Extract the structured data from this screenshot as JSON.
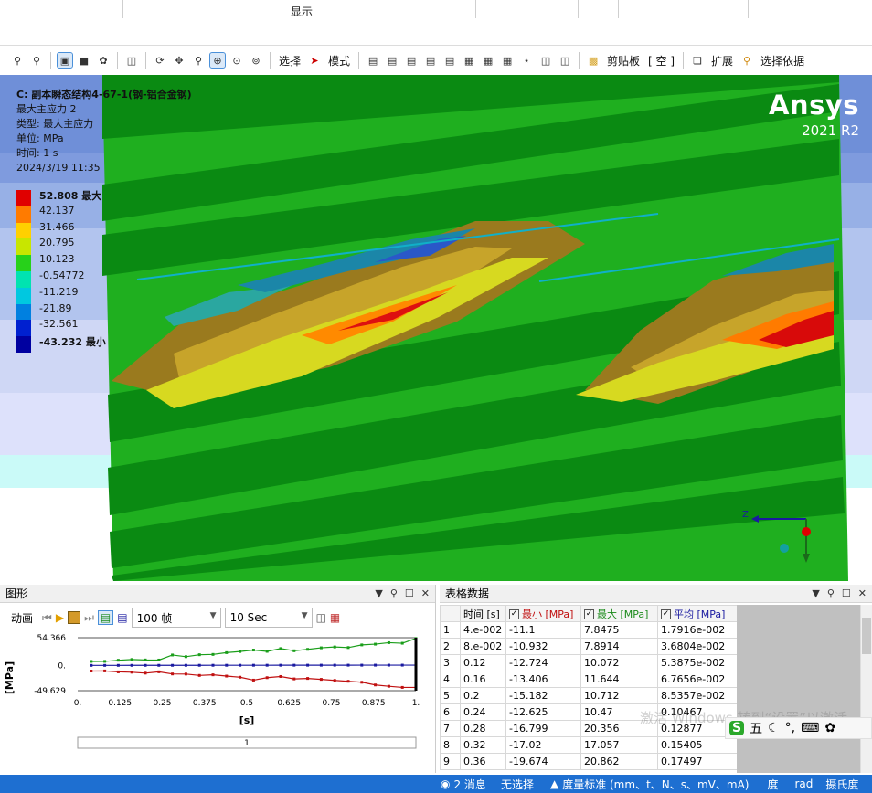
{
  "ribbon": {
    "group_label": "显示"
  },
  "toolbar": {
    "select_label": "选择",
    "mode_label": "模式",
    "clipboard_label": "剪贴板",
    "empty_label": "[ 空 ]",
    "extend_label": "扩展",
    "select_by_label": "选择依据"
  },
  "result_info": {
    "title": "C: 副本瞬态结构4-67-1(钢-铝合金钢)",
    "result_name": "最大主应力 2",
    "type": "类型: 最大主应力",
    "unit": "单位: MPa",
    "time": "时间: 1 s",
    "date": "2024/3/19 11:35"
  },
  "legend": {
    "entries": [
      {
        "value": "52.808 最大",
        "color": "#e00000",
        "bold": true
      },
      {
        "value": "42.137",
        "color": "#ff7b00",
        "bold": false
      },
      {
        "value": "31.466",
        "color": "#ffd000",
        "bold": false
      },
      {
        "value": "20.795",
        "color": "#c8e600",
        "bold": false
      },
      {
        "value": "10.123",
        "color": "#27d11a",
        "bold": false
      },
      {
        "value": "-0.54772",
        "color": "#00e3b0",
        "bold": false
      },
      {
        "value": "-11.219",
        "color": "#00c8e0",
        "bold": false
      },
      {
        "value": "-21.89",
        "color": "#0080e0",
        "bold": false
      },
      {
        "value": "-32.561",
        "color": "#0020d0",
        "bold": false
      },
      {
        "value": "-43.232 最小",
        "color": "#0000a0",
        "bold": true
      }
    ]
  },
  "logo": {
    "name": "Ansys",
    "version": "2021 R2"
  },
  "triad": {
    "axis_label": "Z"
  },
  "graph_panel": {
    "title": "图形",
    "anim_label": "动画",
    "frames": "100 帧",
    "duration": "10 Sec",
    "progress_value": "1"
  },
  "chart_data": {
    "type": "line",
    "ylabel": "[MPa]",
    "xlabel": "[s]",
    "ytick_labels": [
      "54.366",
      "0.",
      "-49.629"
    ],
    "xtick_labels": [
      "0.",
      "0.125",
      "0.25",
      "0.375",
      "0.5",
      "0.625",
      "0.75",
      "0.875",
      "1."
    ],
    "ylim": [
      -49.629,
      54.366
    ],
    "xlim": [
      0,
      1
    ],
    "series": [
      {
        "name": "最大",
        "color": "#1a9e1a",
        "x": [
          0.04,
          0.08,
          0.12,
          0.16,
          0.2,
          0.24,
          0.28,
          0.32,
          0.36,
          0.4,
          0.44,
          0.48,
          0.52,
          0.56,
          0.6,
          0.64,
          0.68,
          0.72,
          0.76,
          0.8,
          0.84,
          0.88,
          0.92,
          0.96,
          1.0
        ],
        "values": [
          7.8,
          7.9,
          10.1,
          11.6,
          10.7,
          10.5,
          20.4,
          17.1,
          20.9,
          21.5,
          25.0,
          27.2,
          30.1,
          27.5,
          33.0,
          28.7,
          31.5,
          34.5,
          36.2,
          35.0,
          40.2,
          41.7,
          44.6,
          43.5,
          52.8
        ]
      },
      {
        "name": "平均",
        "color": "#1a1aa0",
        "x": [
          0.04,
          0.08,
          0.12,
          0.16,
          0.2,
          0.24,
          0.28,
          0.32,
          0.36,
          0.4,
          0.44,
          0.48,
          0.52,
          0.56,
          0.6,
          0.64,
          0.68,
          0.72,
          0.76,
          0.8,
          0.84,
          0.88,
          0.92,
          0.96,
          1.0
        ],
        "values": [
          0.018,
          0.037,
          0.054,
          0.068,
          0.085,
          0.105,
          0.129,
          0.154,
          0.175,
          0.2,
          0.22,
          0.24,
          0.26,
          0.28,
          0.3,
          0.32,
          0.34,
          0.36,
          0.38,
          0.4,
          0.42,
          0.44,
          0.46,
          0.48,
          0.5
        ]
      },
      {
        "name": "最小",
        "color": "#c01010",
        "x": [
          0.04,
          0.08,
          0.12,
          0.16,
          0.2,
          0.24,
          0.28,
          0.32,
          0.36,
          0.4,
          0.44,
          0.48,
          0.52,
          0.56,
          0.6,
          0.64,
          0.68,
          0.72,
          0.76,
          0.8,
          0.84,
          0.88,
          0.92,
          0.96,
          1.0
        ],
        "values": [
          -11.1,
          -10.9,
          -12.7,
          -13.4,
          -15.2,
          -12.6,
          -16.8,
          -17.0,
          -19.7,
          -18.5,
          -21.0,
          -23.2,
          -28.9,
          -24.1,
          -21.8,
          -26.5,
          -25.6,
          -27.4,
          -29.5,
          -31.2,
          -33.1,
          -38.4,
          -41.0,
          -43.2,
          -43.2
        ]
      }
    ]
  },
  "table_panel": {
    "title": "表格数据",
    "columns": [
      "时间 [s]",
      "最小 [MPa]",
      "最大 [MPa]",
      "平均 [MPa]"
    ],
    "column_colors": [
      "#000000",
      "#c01010",
      "#1a8a1a",
      "#1a1aa0"
    ],
    "rows": [
      {
        "idx": "1",
        "time": "4.e-002",
        "min": "-11.1",
        "max": "7.8475",
        "avg": "1.7916e-002"
      },
      {
        "idx": "2",
        "time": "8.e-002",
        "min": "-10.932",
        "max": "7.8914",
        "avg": "3.6804e-002"
      },
      {
        "idx": "3",
        "time": "0.12",
        "min": "-12.724",
        "max": "10.072",
        "avg": "5.3875e-002"
      },
      {
        "idx": "4",
        "time": "0.16",
        "min": "-13.406",
        "max": "11.644",
        "avg": "6.7656e-002"
      },
      {
        "idx": "5",
        "time": "0.2",
        "min": "-15.182",
        "max": "10.712",
        "avg": "8.5357e-002"
      },
      {
        "idx": "6",
        "time": "0.24",
        "min": "-12.625",
        "max": "10.47",
        "avg": "0.10467"
      },
      {
        "idx": "7",
        "time": "0.28",
        "min": "-16.799",
        "max": "20.356",
        "avg": "0.12877"
      },
      {
        "idx": "8",
        "time": "0.32",
        "min": "-17.02",
        "max": "17.057",
        "avg": "0.15405"
      },
      {
        "idx": "9",
        "time": "0.36",
        "min": "-19.674",
        "max": "20.862",
        "avg": "0.17497"
      }
    ]
  },
  "overlay": {
    "watermark": "激活 Windows 转到“设置”以激活",
    "ime_label": "五"
  },
  "status_bar": {
    "messages": "2 消息",
    "selection": "无选择",
    "units": "度量标准 (mm、t、N、s、mV、mA)",
    "angle": "度",
    "rad": "rad",
    "temp": "摄氏度"
  }
}
